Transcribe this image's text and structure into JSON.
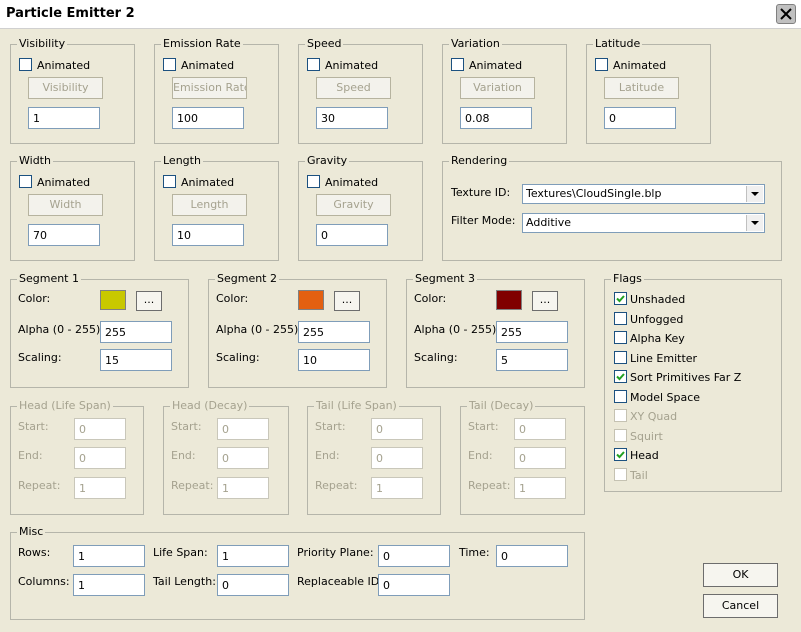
{
  "window": {
    "title": "Particle Emitter 2",
    "close_icon": "close-icon"
  },
  "common": {
    "animated": "Animated"
  },
  "visibility": {
    "title": "Visibility",
    "button": "Visibility",
    "value": "1"
  },
  "emission_rate": {
    "title": "Emission Rate",
    "button": "Emission Rate",
    "value": "100"
  },
  "speed": {
    "title": "Speed",
    "button": "Speed",
    "value": "30"
  },
  "variation": {
    "title": "Variation",
    "button": "Variation",
    "value": "0.08"
  },
  "latitude": {
    "title": "Latitude",
    "button": "Latitude",
    "value": "0"
  },
  "width": {
    "title": "Width",
    "button": "Width",
    "value": "70"
  },
  "length": {
    "title": "Length",
    "button": "Length",
    "value": "10"
  },
  "gravity": {
    "title": "Gravity",
    "button": "Gravity",
    "value": "0"
  },
  "rendering": {
    "title": "Rendering",
    "texture_label": "Texture ID:",
    "texture_value": "Textures\\CloudSingle.blp",
    "filter_label": "Filter Mode:",
    "filter_value": "Additive"
  },
  "segment_labels": {
    "color": "Color:",
    "alpha": "Alpha (0 - 255):",
    "scaling": "Scaling:",
    "more": "..."
  },
  "segments": [
    {
      "title": "Segment 1",
      "color": "#c8c800",
      "alpha": "255",
      "scaling": "15"
    },
    {
      "title": "Segment 2",
      "color": "#e36010",
      "alpha": "255",
      "scaling": "10"
    },
    {
      "title": "Segment 3",
      "color": "#800000",
      "alpha": "255",
      "scaling": "5"
    }
  ],
  "span_labels": {
    "start": "Start:",
    "end": "End:",
    "repeat": "Repeat:"
  },
  "spans": [
    {
      "title": "Head (Life Span)",
      "start": "0",
      "end": "0",
      "repeat": "1"
    },
    {
      "title": "Head (Decay)",
      "start": "0",
      "end": "0",
      "repeat": "1"
    },
    {
      "title": "Tail (Life Span)",
      "start": "0",
      "end": "0",
      "repeat": "1"
    },
    {
      "title": "Tail (Decay)",
      "start": "0",
      "end": "0",
      "repeat": "1"
    }
  ],
  "flags": {
    "title": "Flags",
    "items": [
      {
        "label": "Unshaded",
        "checked": true,
        "enabled": true
      },
      {
        "label": "Unfogged",
        "checked": false,
        "enabled": true
      },
      {
        "label": "Alpha Key",
        "checked": false,
        "enabled": true
      },
      {
        "label": "Line Emitter",
        "checked": false,
        "enabled": true
      },
      {
        "label": "Sort Primitives Far Z",
        "checked": true,
        "enabled": true
      },
      {
        "label": "Model Space",
        "checked": false,
        "enabled": true
      },
      {
        "label": "XY Quad",
        "checked": false,
        "enabled": false
      },
      {
        "label": "Squirt",
        "checked": false,
        "enabled": false
      },
      {
        "label": "Head",
        "checked": true,
        "enabled": true
      },
      {
        "label": "Tail",
        "checked": false,
        "enabled": false
      }
    ]
  },
  "misc": {
    "title": "Misc",
    "rows_label": "Rows:",
    "rows": "1",
    "columns_label": "Columns:",
    "columns": "1",
    "life_span_label": "Life Span:",
    "life_span": "1",
    "tail_length_label": "Tail Length:",
    "tail_length": "0",
    "priority_label": "Priority Plane:",
    "priority": "0",
    "replaceable_label": "Replaceable ID:",
    "replaceable": "0",
    "time_label": "Time:",
    "time": "0"
  },
  "buttons": {
    "ok": "OK",
    "cancel": "Cancel"
  }
}
